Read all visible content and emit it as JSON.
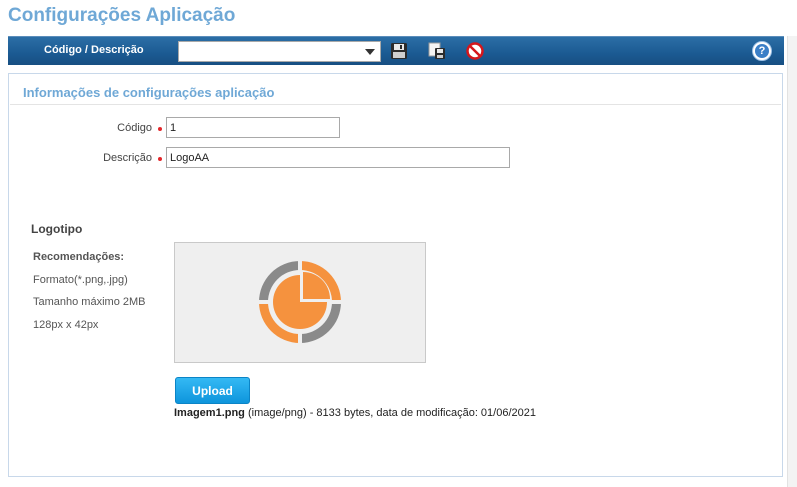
{
  "page": {
    "title": "Configurações Aplicação"
  },
  "toolbar": {
    "label": "Código / Descrição",
    "select_value": "",
    "icons": {
      "save": "floppy-disk-icon",
      "save_as": "save-as-icon",
      "cancel": "cancel-icon",
      "help": "help-icon"
    },
    "help_glyph": "?"
  },
  "panel": {
    "title": "Informações de configurações aplicação",
    "codigo_label": "Código",
    "codigo_value": "1",
    "descricao_label": "Descrição",
    "descricao_value": "LogoAA"
  },
  "logo": {
    "heading": "Logotipo",
    "rec_title": "Recomendações:",
    "rec_format": "Formato(*.png,.jpg)",
    "rec_size": "Tamanho máximo 2MB",
    "rec_dims": "128px x 42px",
    "upload_label": "Upload",
    "file_name": "Imagem1.png",
    "file_details": " (image/png) - 8133 bytes, data de modificação: 01/06/2021"
  },
  "colors": {
    "accent": "#6fa8d6",
    "toolbar": "#1b5a92",
    "upload": "#1aa6ea",
    "logo_orange": "#f5923e",
    "logo_gray": "#8a8a8a",
    "required": "#e3262a"
  }
}
